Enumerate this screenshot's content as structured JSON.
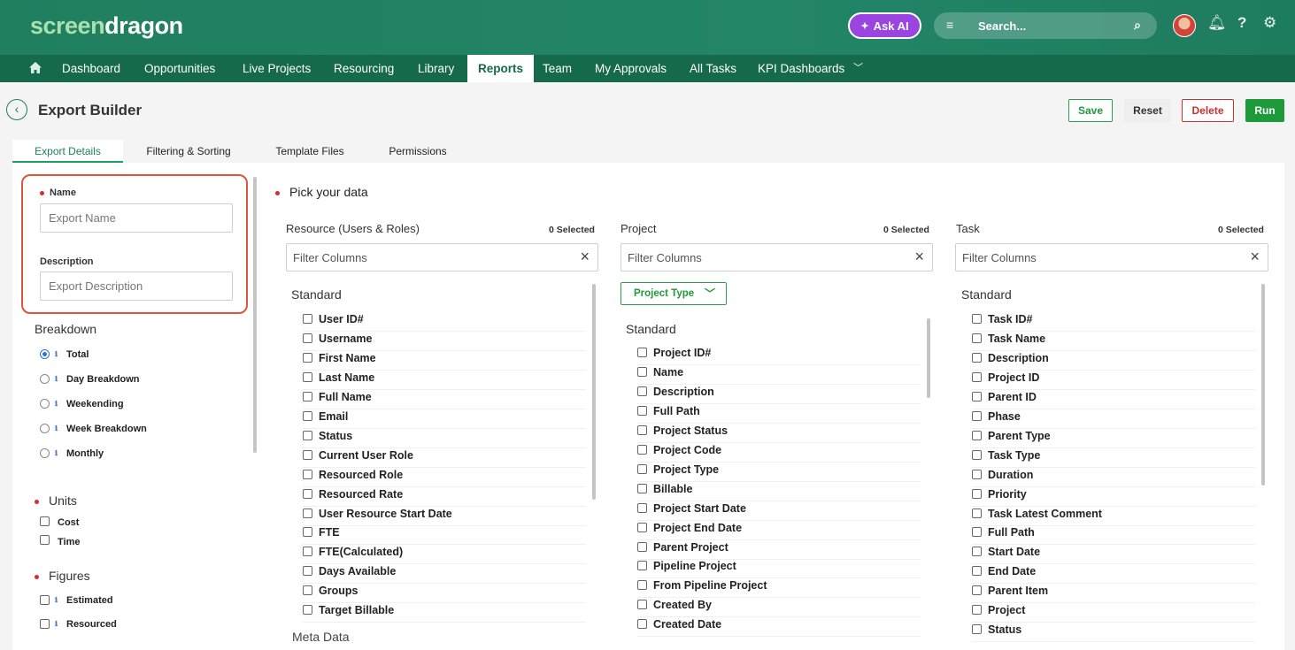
{
  "brand": {
    "logo_part1": "screen",
    "logo_part2": "dragon"
  },
  "header": {
    "ask_ai_label": "Ask AI",
    "search_label": "Search..."
  },
  "nav": {
    "items": [
      "Dashboard",
      "Opportunities",
      "Live Projects",
      "Resourcing",
      "Library",
      "Reports",
      "Team",
      "My Approvals",
      "All Tasks",
      "KPI Dashboards"
    ],
    "active": "Reports"
  },
  "page": {
    "title": "Export Builder",
    "buttons": {
      "save": "Save",
      "reset": "Reset",
      "delete": "Delete",
      "run": "Run"
    }
  },
  "tabs": [
    "Export Details",
    "Filtering & Sorting",
    "Template Files",
    "Permissions"
  ],
  "form": {
    "name_label": "Name",
    "name_placeholder": "Export Name",
    "description_label": "Description",
    "description_placeholder": "Export Description"
  },
  "breakdown": {
    "title": "Breakdown",
    "options": [
      "Total",
      "Day Breakdown",
      "Weekending",
      "Week Breakdown",
      "Monthly"
    ],
    "selected": "Total"
  },
  "units": {
    "title": "Units",
    "options": [
      "Cost",
      "Time"
    ]
  },
  "figures": {
    "title": "Figures",
    "options": [
      "Estimated",
      "Resourced"
    ]
  },
  "pick": {
    "title": "Pick your data",
    "filter_placeholder": "Filter Columns",
    "columns": [
      {
        "header": "Resource (Users & Roles)",
        "count": "0 Selected",
        "section": "Standard",
        "next_section": "Meta Data",
        "items": [
          "User ID#",
          "Username",
          "First Name",
          "Last Name",
          "Full Name",
          "Email",
          "Status",
          "Current User Role",
          "Resourced Role",
          "Resourced Rate",
          "User Resource Start Date",
          "FTE",
          "FTE(Calculated)",
          "Days Available",
          "Groups",
          "Target Billable"
        ]
      },
      {
        "header": "Project",
        "count": "0 Selected",
        "dropdown": "Project Type",
        "section": "Standard",
        "items": [
          "Project ID#",
          "Name",
          "Description",
          "Full Path",
          "Project Status",
          "Project Code",
          "Project Type",
          "Billable",
          "Project Start Date",
          "Project End Date",
          "Parent Project",
          "Pipeline Project",
          "From Pipeline Project",
          "Created By",
          "Created Date"
        ]
      },
      {
        "header": "Task",
        "count": "0 Selected",
        "section": "Standard",
        "items": [
          "Task ID#",
          "Task Name",
          "Description",
          "Project ID",
          "Parent ID",
          "Phase",
          "Parent Type",
          "Task Type",
          "Duration",
          "Priority",
          "Task Latest Comment",
          "Full Path",
          "Start Date",
          "End Date",
          "Parent Item",
          "Project",
          "Status"
        ]
      }
    ]
  }
}
